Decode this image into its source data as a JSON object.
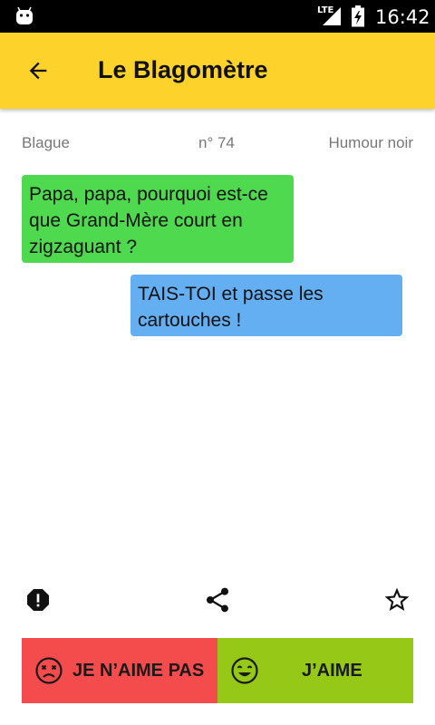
{
  "status_bar": {
    "network": "LTE",
    "time": "16:42",
    "icons": [
      "android-icon",
      "signal-icon",
      "battery-charging-icon"
    ]
  },
  "app_bar": {
    "title": "Le Blagomètre",
    "back_icon": "arrow-back-icon"
  },
  "joke": {
    "label": "Blague",
    "number": "n° 74",
    "category": "Humour noir",
    "question": "Papa, papa, pourquoi est-ce que Grand-Mère court en zigzaguant ?",
    "answer": "TAIS-TOI et passe les cartouches !"
  },
  "actions": {
    "report_icon": "report-icon",
    "share_icon": "share-icon",
    "favorite_icon": "star-outline-icon"
  },
  "vote": {
    "dislike_label": "JE N’AIME PAS",
    "like_label": "J’AIME"
  },
  "colors": {
    "app_bar": "#fdd22a",
    "question_bubble": "#4ed94e",
    "answer_bubble": "#64aef2",
    "dislike": "#f44c4c",
    "like": "#96c917"
  }
}
